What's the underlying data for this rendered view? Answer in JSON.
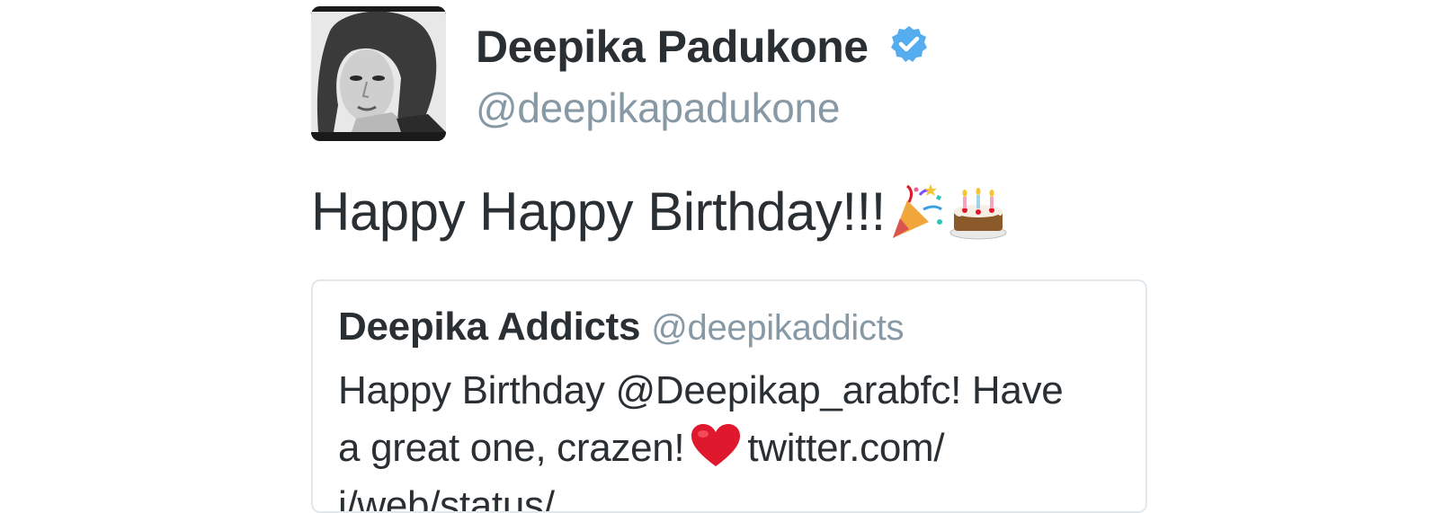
{
  "author": {
    "display_name": "Deepika Padukone",
    "handle": "@deepikapadukone",
    "verified": true,
    "avatar_icon": "profile-photo"
  },
  "tweet": {
    "text": "Happy Happy Birthday!!!",
    "emojis": [
      "party-popper-icon",
      "birthday-cake-icon"
    ]
  },
  "quoted_tweet": {
    "display_name": "Deepika Addicts",
    "handle": "@deepikaddicts",
    "text_line1": "Happy Birthday @Deepikap_arabfc! Have",
    "text_line2_before": "a great one, crazen!",
    "text_line2_after": "twitter.com/",
    "text_line3": "i/web/status/...",
    "emoji": "heart-icon"
  },
  "colors": {
    "text": "#292f33",
    "secondary_text": "#8899a6",
    "verified_badge": "#55acee",
    "card_border": "#e1e8ed",
    "heart": "#e0182d"
  }
}
